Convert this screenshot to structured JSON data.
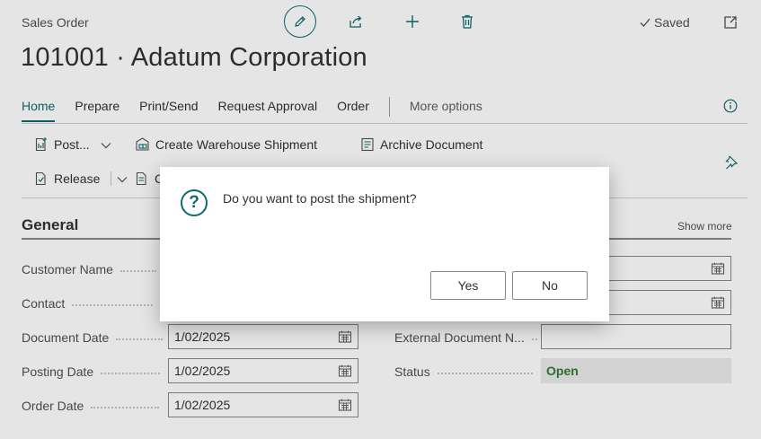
{
  "header": {
    "document_type": "Sales Order",
    "title": "101001 · Adatum Corporation",
    "saved_label": "Saved"
  },
  "action_bar": {
    "tabs": [
      {
        "label": "Home",
        "active": true
      },
      {
        "label": "Prepare"
      },
      {
        "label": "Print/Send"
      },
      {
        "label": "Request Approval"
      },
      {
        "label": "Order"
      }
    ],
    "more_options": "More options",
    "actions": {
      "post": "Post...",
      "create_warehouse_shipment": "Create Warehouse Shipment",
      "archive_document": "Archive Document",
      "release": "Release",
      "partial_c": "C"
    }
  },
  "general": {
    "title": "General",
    "show_more": "Show more",
    "fields": {
      "customer_name": {
        "label": "Customer Name"
      },
      "contact": {
        "label": "Contact"
      },
      "document_date": {
        "label": "Document Date",
        "value": "1/02/2025"
      },
      "posting_date": {
        "label": "Posting Date",
        "value": "1/02/2025"
      },
      "order_date": {
        "label": "Order Date",
        "value": "1/02/2025"
      },
      "external_document_no": {
        "label": "External Document N...",
        "value": ""
      },
      "status": {
        "label": "Status",
        "value": "Open"
      }
    }
  },
  "dialog": {
    "icon": "question-circle-icon",
    "message": "Do you want to post the shipment?",
    "yes_label": "Yes",
    "no_label": "No"
  },
  "colors": {
    "accent": "#0f6b6b",
    "status_open": "#2e7d32"
  }
}
